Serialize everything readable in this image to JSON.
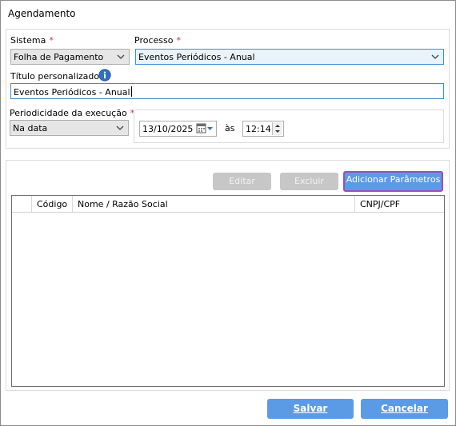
{
  "window": {
    "title": "Agendamento"
  },
  "form": {
    "sistema": {
      "label": "Sistema",
      "required": "*",
      "value": "Folha de Pagamento"
    },
    "processo": {
      "label": "Processo",
      "required": "*",
      "value": "Eventos Periódicos - Anual"
    },
    "titulo": {
      "label": "Título personalizado",
      "required": "*",
      "value": "Eventos Periódicos - Anual",
      "info_icon": "info-icon"
    },
    "periodicidade": {
      "label": "Periodicidade da execução",
      "required": "*",
      "value": "Na data"
    },
    "date": {
      "value": "13/10/2025",
      "icon": "calendar-icon"
    },
    "as_label": "às",
    "time": {
      "value": "12:14"
    }
  },
  "actions": {
    "editar": "Editar",
    "excluir": "Excluir",
    "adicionar": "Adicionar Parâmetros"
  },
  "table": {
    "columns": [
      "",
      "Código",
      "Nome / Razão Social",
      "CNPJ/CPF"
    ],
    "rows": []
  },
  "footer": {
    "salvar": "Salvar",
    "cancelar": "Cancelar"
  },
  "colors": {
    "primary": "#5b9be6",
    "disabled": "#c7c7c7",
    "required": "#e2262b",
    "highlight": "#9b4fb7",
    "focus": "#3b8fd6"
  }
}
